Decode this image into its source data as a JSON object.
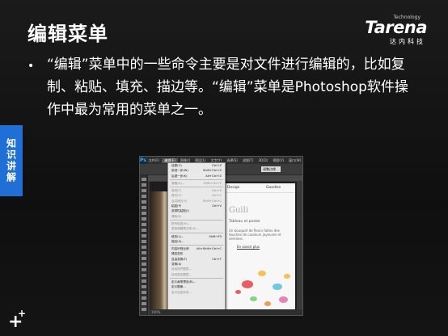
{
  "slide": {
    "title": "编辑菜单",
    "logo": {
      "tagline": "Technology",
      "name": "Tarena",
      "cn": "达内科技"
    },
    "bullet": "•",
    "body": "“编辑”菜单中的一些命令主要是对文件进行编辑的，比如复制、粘贴、填充、描边等。“编辑”菜单是Photoshop软件操作中最为常用的菜单之一。",
    "side_tab": "知识讲解",
    "plus_big": "+",
    "plus_small": "+"
  },
  "photoshop": {
    "app_icon": "Ps",
    "menubar": [
      "文件(F)",
      "编辑(E)",
      "图像(I)",
      "图层(L)",
      "文字(Y)",
      "选择(S)",
      "滤镜(T)",
      "3D(D)",
      "视图(V)",
      "窗口(W)",
      "帮助(H)"
    ],
    "active_menu_index": 1,
    "option_boxes": [
      "调整边缘..."
    ],
    "web_page": {
      "nav": [
        "Design",
        "Goodies"
      ],
      "heading": "Guili",
      "sub": "Tableau et poster",
      "para": "Un bouquet de fleurs faites des touches de couleurs joyeuses et sereines.",
      "link": "En savoir plus"
    },
    "status_zoom": "100%",
    "edit_menu": [
      {
        "label": "还原(O)",
        "shortcut": "Ctrl+Z",
        "dim": false
      },
      {
        "label": "前进一步(W)",
        "shortcut": "Shift+Ctrl+Z",
        "dim": false
      },
      {
        "label": "后退一步(K)",
        "shortcut": "Alt+Ctrl+Z",
        "dim": false
      },
      {
        "sep": true
      },
      {
        "label": "渐隐(D)...",
        "shortcut": "Shift+Ctrl+F",
        "dim": true
      },
      {
        "sep": true
      },
      {
        "label": "剪切(T)",
        "shortcut": "Ctrl+X",
        "dim": true
      },
      {
        "label": "拷贝(C)",
        "shortcut": "Ctrl+C",
        "dim": true
      },
      {
        "label": "合并拷贝(Y)",
        "shortcut": "Shift+Ctrl+C",
        "dim": true
      },
      {
        "label": "粘贴(P)",
        "shortcut": "Ctrl+V",
        "dim": false
      },
      {
        "label": "选择性粘贴(I)",
        "shortcut": "",
        "dim": false
      },
      {
        "label": "清除(E)",
        "shortcut": "",
        "dim": true
      },
      {
        "sep": true
      },
      {
        "label": "拼写检查(H)...",
        "shortcut": "",
        "dim": true
      },
      {
        "label": "查找和替换文本(X)...",
        "shortcut": "",
        "dim": true
      },
      {
        "sep": true
      },
      {
        "label": "填充(L)...",
        "shortcut": "Shift+F5",
        "dim": false
      },
      {
        "label": "描边(S)...",
        "shortcut": "",
        "dim": false
      },
      {
        "sep": true
      },
      {
        "label": "内容识别比例",
        "shortcut": "Alt+Shift+Ctrl+C",
        "dim": false
      },
      {
        "label": "操控变形",
        "shortcut": "",
        "dim": false
      },
      {
        "label": "自由变换(F)",
        "shortcut": "Ctrl+T",
        "dim": false
      },
      {
        "label": "变换(A)",
        "shortcut": "",
        "dim": false
      },
      {
        "label": "自动对齐图层...",
        "shortcut": "",
        "dim": true
      },
      {
        "label": "自动混合图层...",
        "shortcut": "",
        "dim": true
      },
      {
        "sep": true
      },
      {
        "label": "定义画笔预设(B)...",
        "shortcut": "",
        "dim": false
      },
      {
        "label": "定义图案...",
        "shortcut": "",
        "dim": false
      },
      {
        "label": "定义自定形状...",
        "shortcut": "",
        "dim": true
      }
    ],
    "splash_colors": [
      "#e8424a",
      "#f4b73a",
      "#5bc0de",
      "#7bc96f",
      "#e86fa8",
      "#f08a3a"
    ]
  }
}
